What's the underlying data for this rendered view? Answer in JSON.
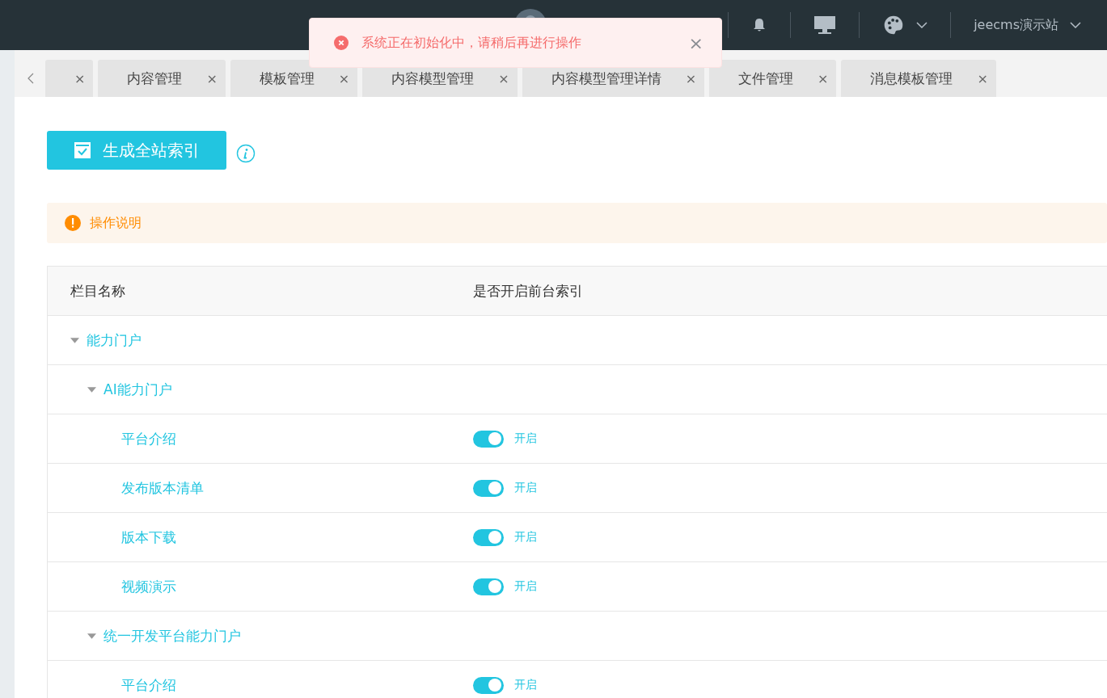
{
  "header": {
    "site_name": "jeecms演示站"
  },
  "toast": {
    "message": "系统正在初始化中，请稍后再进行操作",
    "close": "×"
  },
  "tabs": [
    {
      "close": "×"
    },
    {
      "label": "内容管理",
      "close": "×"
    },
    {
      "label": "模板管理",
      "close": "×"
    },
    {
      "label": "内容模型管理",
      "close": "×"
    },
    {
      "label": "内容模型管理详情",
      "close": "×"
    },
    {
      "label": "文件管理",
      "close": "×"
    },
    {
      "label": "消息模板管理",
      "close": "×"
    }
  ],
  "generate_button": "生成全站索引",
  "notice": "操作说明",
  "table": {
    "columns": [
      "栏目名称",
      "是否开启前台索引"
    ],
    "rows": [
      {
        "name": "能力门户",
        "expanded": true,
        "children": [
          {
            "name": "AI能力门户",
            "expanded": true,
            "children": [
              {
                "name": "平台介绍",
                "on": true,
                "switch_label": "开启"
              },
              {
                "name": "发布版本清单",
                "on": true,
                "switch_label": "开启"
              },
              {
                "name": "版本下载",
                "on": true,
                "switch_label": "开启"
              },
              {
                "name": "视频演示",
                "on": true,
                "switch_label": "开启"
              }
            ]
          },
          {
            "name": "统一开发平台能力门户",
            "expanded": true,
            "children": [
              {
                "name": "平台介绍",
                "on": true,
                "switch_label": "开启"
              }
            ]
          }
        ]
      }
    ]
  }
}
